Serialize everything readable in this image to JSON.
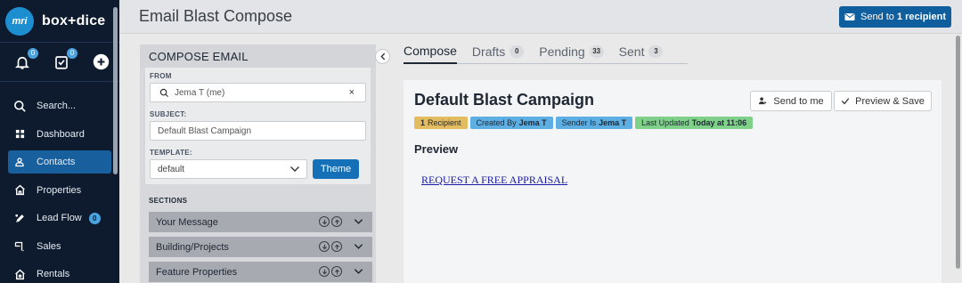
{
  "app": {
    "logo_text": "mri",
    "brand": "box+dice",
    "quick": {
      "notifications_count": "0",
      "tasks_count": "0"
    }
  },
  "sidebar": {
    "items": [
      {
        "label": "Search...",
        "icon": "search-icon"
      },
      {
        "label": "Dashboard",
        "icon": "dashboard-icon"
      },
      {
        "label": "Contacts",
        "icon": "contact-icon",
        "active": true
      },
      {
        "label": "Properties",
        "icon": "home-icon"
      },
      {
        "label": "Lead Flow",
        "icon": "lead-flow-icon",
        "badge": "0"
      },
      {
        "label": "Sales",
        "icon": "sales-icon"
      },
      {
        "label": "Rentals",
        "icon": "rentals-icon"
      }
    ]
  },
  "header": {
    "title": "Email Blast Compose",
    "send_prefix": "Send to",
    "send_count": "1 recipient"
  },
  "compose": {
    "heading": "COMPOSE EMAIL",
    "from_label": "FROM",
    "from_value": "Jema T (me)",
    "from_clear": "×",
    "subject_label": "SUBJECT:",
    "subject_value": "Default Blast Campaign",
    "template_label": "TEMPLATE:",
    "template_value": "default",
    "theme_button": "Theme",
    "sections_label": "SECTIONS",
    "sections": [
      "Your Message",
      "Building/Projects",
      "Feature Properties"
    ]
  },
  "tabs": [
    {
      "label": "Compose",
      "active": true
    },
    {
      "label": "Drafts",
      "count": "0"
    },
    {
      "label": "Pending",
      "count": "33"
    },
    {
      "label": "Sent",
      "count": "3"
    }
  ],
  "preview": {
    "title": "Default Blast Campaign",
    "send_to_me": "Send to me",
    "preview_save": "Preview & Save",
    "badges": {
      "recipient_count": "1",
      "recipient_label": "Recipient",
      "created_label": "Created By",
      "created_value": "Jema T",
      "sender_label": "Sender Is",
      "sender_value": "Jema T",
      "updated_label": "Last Updated",
      "updated_value": "Today at 11:06"
    },
    "section_label": "Preview",
    "link_text": "REQUEST A FREE APPRAISAL"
  },
  "colors": {
    "sidebar_bg": "#0e1b2e",
    "sidebar_active": "#17609d",
    "primary_button": "#0f5f9f",
    "badge_yellow": "#e3bc5f",
    "badge_blue": "#5daee3",
    "badge_green": "#7fd089"
  }
}
